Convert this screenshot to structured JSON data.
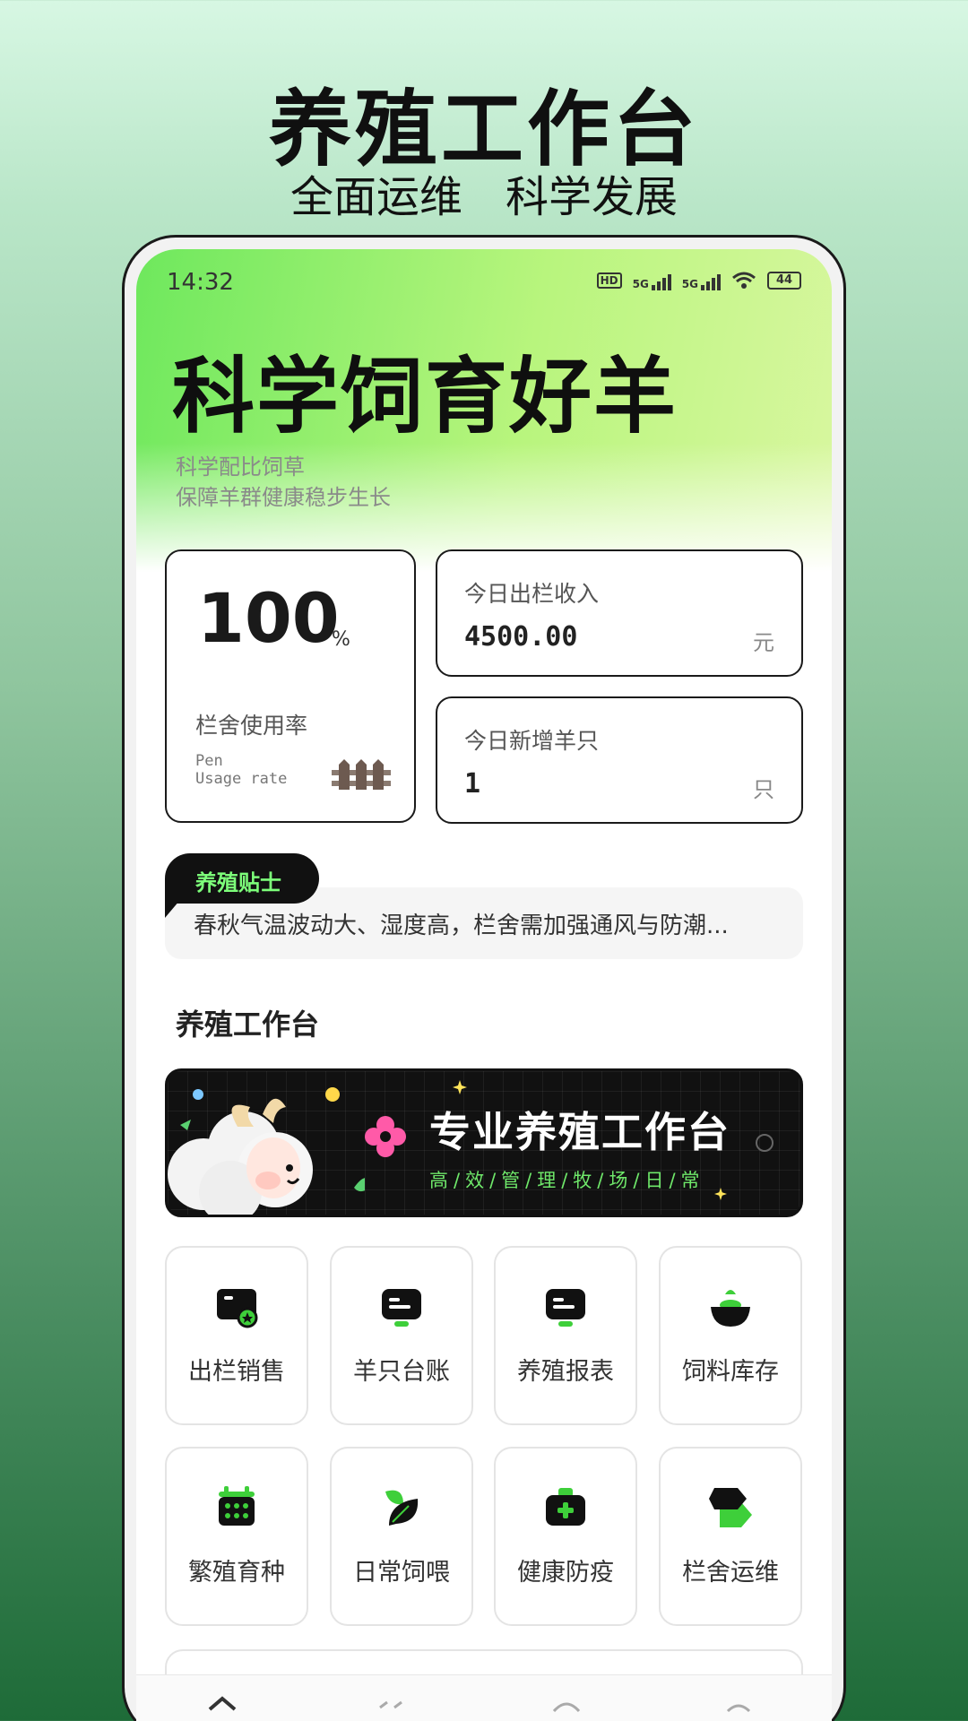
{
  "promo": {
    "title": "养殖工作台",
    "subtitle": "全面运维　科学发展"
  },
  "status_bar": {
    "time": "14:32",
    "hd_label": "HD",
    "net1": "5G",
    "net2": "5G",
    "battery": "44"
  },
  "hero": {
    "title": "科学饲育好羊",
    "desc_line1": "科学配比饲草",
    "desc_line2": "保障羊群健康稳步生长"
  },
  "stats": {
    "usage": {
      "value": "100",
      "unit": "%",
      "label": "栏舍使用率",
      "en_label": "Pen\nUsage rate",
      "icon": "fence-icon"
    },
    "income": {
      "label": "今日出栏收入",
      "value": "4500.00",
      "unit": "元"
    },
    "new_sheep": {
      "label": "今日新增羊只",
      "value": "1",
      "unit": "只"
    }
  },
  "tip": {
    "badge": "养殖贴士",
    "text": "春秋气温波动大、湿度高，栏舍需加强通风与防潮..."
  },
  "section": {
    "title": "养殖工作台"
  },
  "banner": {
    "title": "专业养殖工作台",
    "subtitle": "高/效/管/理/牧/场/日/常"
  },
  "modules": [
    {
      "label": "出栏销售",
      "icon": "sales-icon"
    },
    {
      "label": "羊只台账",
      "icon": "ledger-icon"
    },
    {
      "label": "养殖报表",
      "icon": "report-icon"
    },
    {
      "label": "饲料库存",
      "icon": "feed-bowl-icon"
    },
    {
      "label": "繁殖育种",
      "icon": "calendar-icon"
    },
    {
      "label": "日常饲喂",
      "icon": "leaf-icon"
    },
    {
      "label": "健康防疫",
      "icon": "medical-kit-icon"
    },
    {
      "label": "栏舍运维",
      "icon": "tag-icon"
    }
  ],
  "colors": {
    "accent_green": "#3ecf3a",
    "badge_text": "#7dff7a",
    "dark": "#111111"
  }
}
